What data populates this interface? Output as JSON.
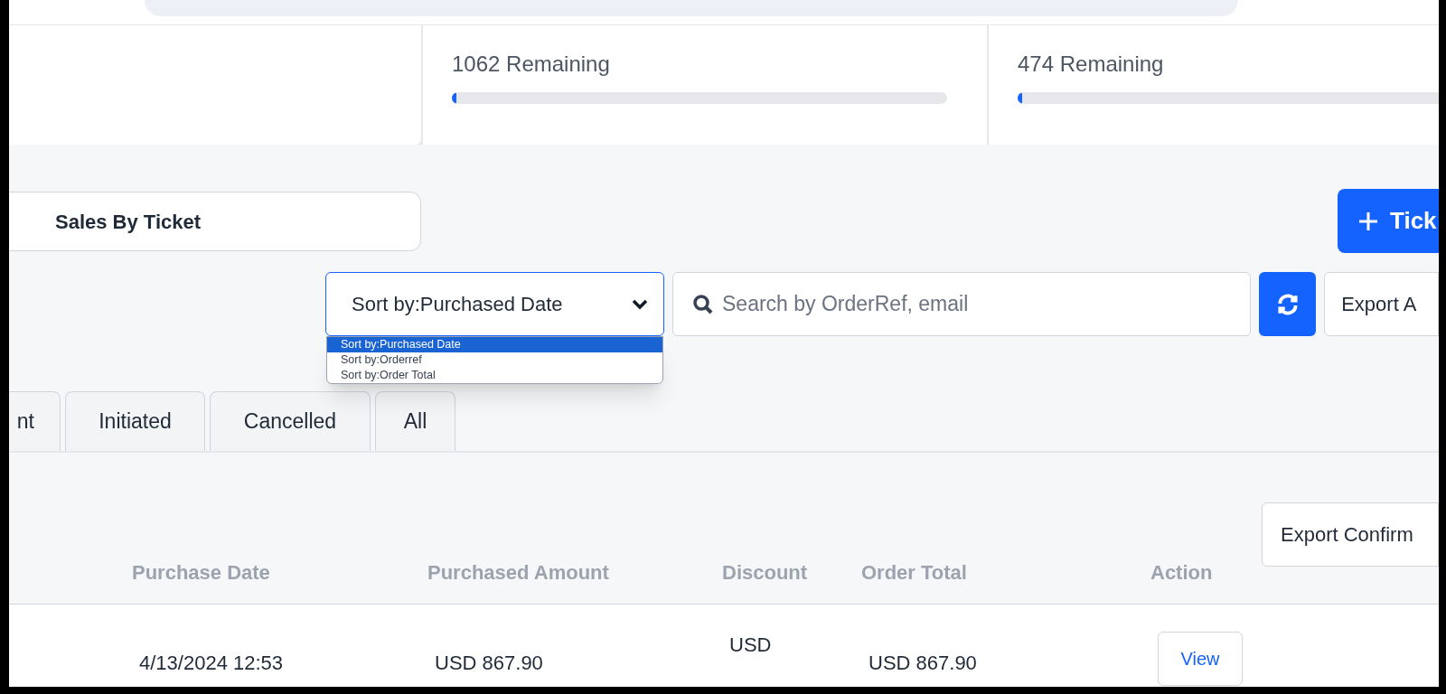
{
  "stats": [
    {
      "remaining": "1062 Remaining",
      "level": 0.01
    },
    {
      "remaining": "474 Remaining",
      "level": 0.01
    }
  ],
  "report_tabs": [
    {
      "label": "Sales By Ticket",
      "selected": false
    }
  ],
  "add_button": {
    "label": "Tick"
  },
  "sort_select": {
    "value": "Sort by:Purchased Date",
    "options": [
      {
        "label": "Sort by:Purchased Date",
        "selected": true
      },
      {
        "label": "Sort by:Orderref",
        "selected": false
      },
      {
        "label": "Sort by:Order Total",
        "selected": false
      }
    ]
  },
  "search": {
    "placeholder": "Search by OrderRef, email"
  },
  "export_all": {
    "label": "Export A"
  },
  "status_tabs": [
    {
      "label": "nt",
      "selected": false
    },
    {
      "label": "Initiated",
      "selected": false
    },
    {
      "label": "Cancelled",
      "selected": false
    },
    {
      "label": "All",
      "selected": false
    }
  ],
  "export_confirmed": {
    "label": "Export Confirm"
  },
  "table": {
    "columns": [
      "Purchase Date",
      "Purchased Amount",
      "Discount",
      "Order Total",
      "Action"
    ],
    "rows": [
      {
        "purchase_date": "4/13/2024 12:53",
        "purchased_amount": "USD 867.90",
        "discount": "USD",
        "order_total": "USD 867.90",
        "action": "View"
      }
    ]
  }
}
